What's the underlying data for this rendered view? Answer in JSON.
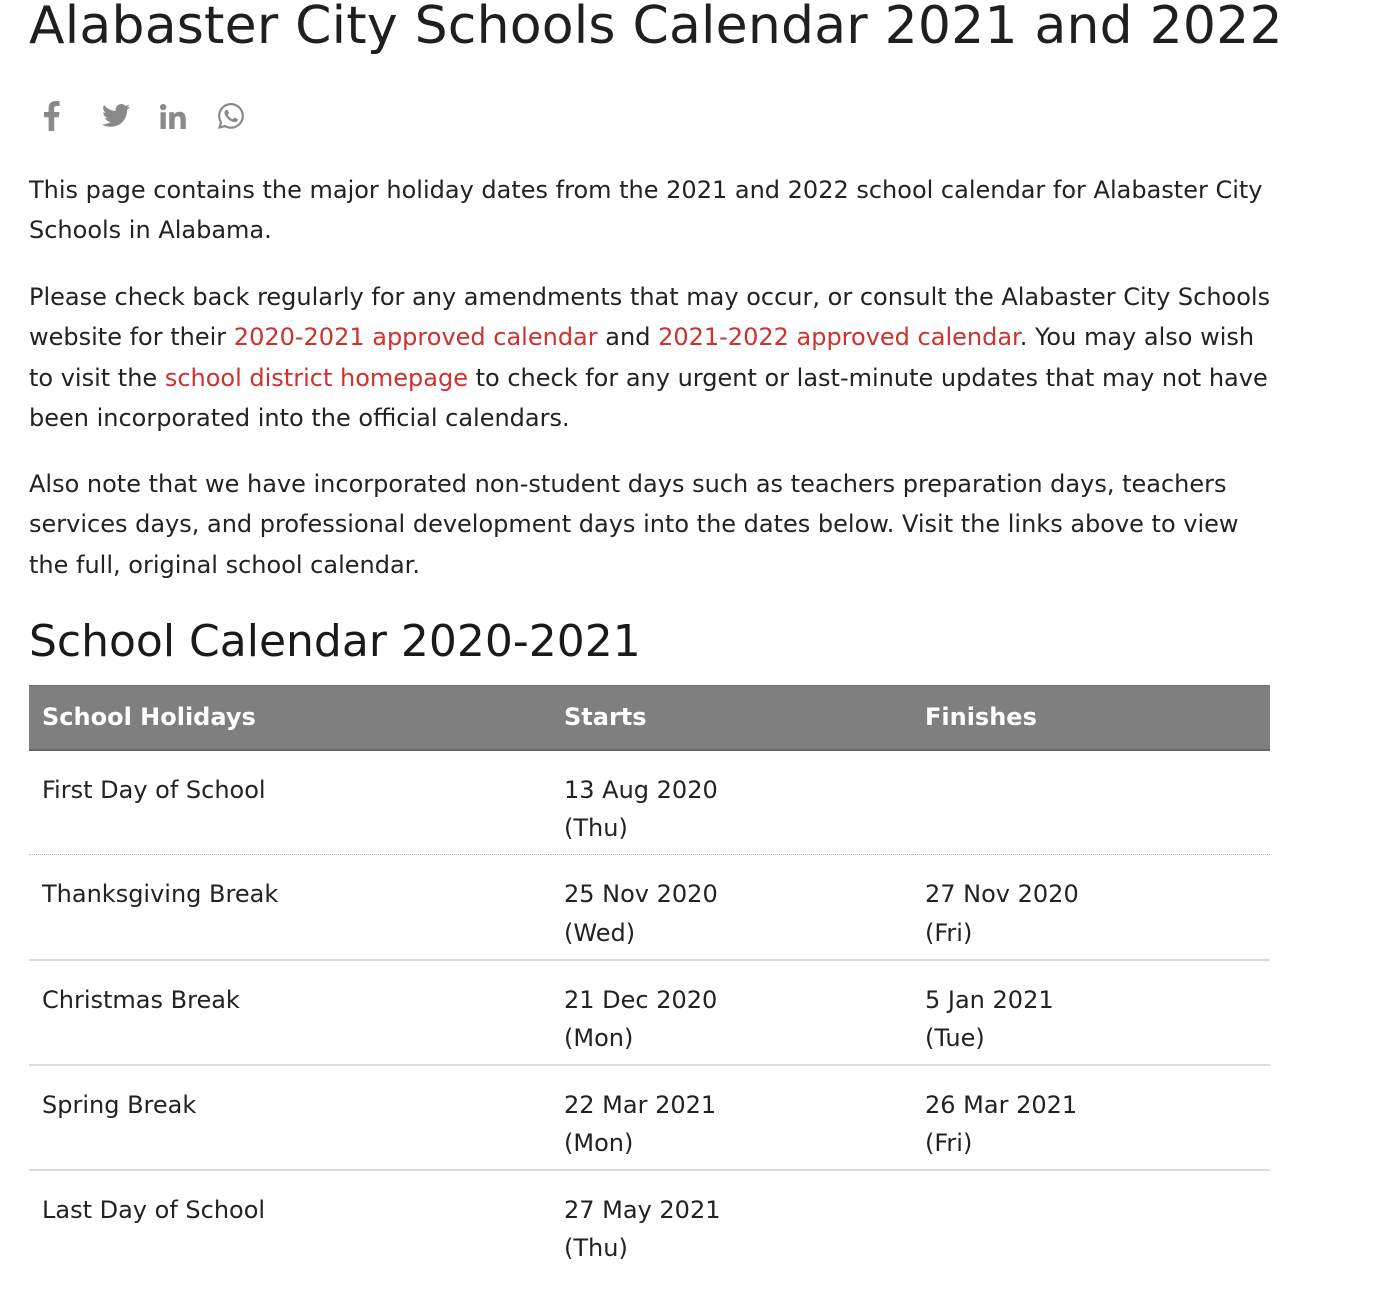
{
  "page": {
    "title": "Alabaster City Schools Calendar 2021 and 2022"
  },
  "share": {
    "icons": [
      "facebook-icon",
      "twitter-icon",
      "linkedin-icon",
      "whatsapp-icon"
    ],
    "color": "#8a8a8a"
  },
  "intro": {
    "p1": "This page contains the major holiday dates from the 2021 and 2022 school calendar for Alabaster City Schools in Alabama.",
    "p2_a": "Please check back regularly for any amendments that may occur, or consult the Alabaster City Schools website for their ",
    "p2_link1": "2020-2021 approved calendar",
    "p2_b": " and ",
    "p2_link2": "2021-2022 approved calendar",
    "p2_c": ". You may also wish to visit the ",
    "p2_link3": "school district homepage",
    "p2_d": " to check for any urgent or last-minute updates that may not have been incorporated into the official calendars.",
    "p3": "Also note that we have incorporated non-student days such as teachers preparation days, teachers services days, and professional development days into the dates below. Visit the links above to view the full, original school calendar."
  },
  "link_color": "#d0302e",
  "calendar": {
    "heading": "School Calendar 2020-2021",
    "header_bg": "#7f7f7f",
    "columns": [
      "School Holidays",
      "Starts",
      "Finishes"
    ],
    "rows": [
      {
        "holiday": "First Day of School",
        "start_date": "13 Aug 2020",
        "start_day": "(Thu)",
        "end_date": "",
        "end_day": ""
      },
      {
        "holiday": "Thanksgiving Break",
        "start_date": "25 Nov 2020",
        "start_day": "(Wed)",
        "end_date": "27 Nov 2020",
        "end_day": "(Fri)"
      },
      {
        "holiday": "Christmas Break",
        "start_date": "21 Dec 2020",
        "start_day": "(Mon)",
        "end_date": "5 Jan 2021",
        "end_day": "(Tue)"
      },
      {
        "holiday": "Spring Break",
        "start_date": "22 Mar 2021",
        "start_day": "(Mon)",
        "end_date": "26 Mar 2021",
        "end_day": "(Fri)"
      },
      {
        "holiday": "Last Day of School",
        "start_date": "27 May 2021",
        "start_day": "(Thu)",
        "end_date": "",
        "end_day": ""
      }
    ]
  }
}
